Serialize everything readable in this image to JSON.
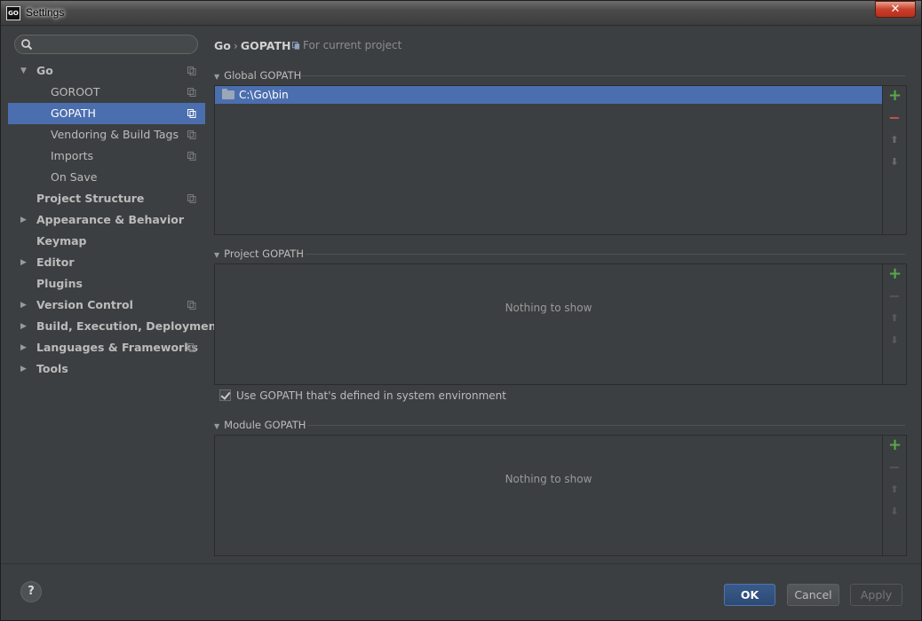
{
  "window": {
    "title": "Settings",
    "app_icon_text": "GO",
    "close_glyph": "✕"
  },
  "search": {
    "placeholder": ""
  },
  "sidebar": {
    "items": [
      {
        "label": "Go",
        "bold": true,
        "expanded": true,
        "has_arrow": true,
        "indent": 1,
        "project_icon": true,
        "selected": false
      },
      {
        "label": "GOROOT",
        "bold": false,
        "has_arrow": false,
        "indent": 2,
        "project_icon": true,
        "selected": false
      },
      {
        "label": "GOPATH",
        "bold": false,
        "has_arrow": false,
        "indent": 2,
        "project_icon": true,
        "selected": true
      },
      {
        "label": "Vendoring & Build Tags",
        "bold": false,
        "has_arrow": false,
        "indent": 2,
        "project_icon": true,
        "selected": false
      },
      {
        "label": "Imports",
        "bold": false,
        "has_arrow": false,
        "indent": 2,
        "project_icon": true,
        "selected": false
      },
      {
        "label": "On Save",
        "bold": false,
        "has_arrow": false,
        "indent": 2,
        "project_icon": false,
        "selected": false
      },
      {
        "label": "Project Structure",
        "bold": true,
        "has_arrow": false,
        "indent": 1,
        "project_icon": true,
        "selected": false
      },
      {
        "label": "Appearance & Behavior",
        "bold": true,
        "has_arrow": true,
        "expanded": false,
        "indent": 1,
        "project_icon": false,
        "selected": false
      },
      {
        "label": "Keymap",
        "bold": true,
        "has_arrow": false,
        "indent": 1,
        "project_icon": false,
        "selected": false
      },
      {
        "label": "Editor",
        "bold": true,
        "has_arrow": true,
        "expanded": false,
        "indent": 1,
        "project_icon": false,
        "selected": false
      },
      {
        "label": "Plugins",
        "bold": true,
        "has_arrow": false,
        "indent": 1,
        "project_icon": false,
        "selected": false
      },
      {
        "label": "Version Control",
        "bold": true,
        "has_arrow": true,
        "expanded": false,
        "indent": 1,
        "project_icon": true,
        "selected": false
      },
      {
        "label": "Build, Execution, Deployment",
        "bold": true,
        "has_arrow": true,
        "expanded": false,
        "indent": 1,
        "project_icon": false,
        "selected": false
      },
      {
        "label": "Languages & Frameworks",
        "bold": true,
        "has_arrow": true,
        "expanded": false,
        "indent": 1,
        "project_icon": true,
        "selected": false
      },
      {
        "label": "Tools",
        "bold": true,
        "has_arrow": true,
        "expanded": false,
        "indent": 1,
        "project_icon": false,
        "selected": false
      }
    ]
  },
  "main": {
    "breadcrumb": {
      "parent": "Go",
      "separator": "›",
      "current": "GOPATH"
    },
    "hint": "For current project",
    "global_gopath": {
      "title": "Global GOPATH",
      "entries": [
        "C:\\Go\\bin"
      ]
    },
    "project_gopath": {
      "title": "Project GOPATH",
      "empty_text": "Nothing to show"
    },
    "use_system_env": {
      "label": "Use GOPATH that's defined in system environment",
      "checked": true
    },
    "module_gopath": {
      "title": "Module GOPATH",
      "empty_text": "Nothing to show"
    },
    "toolbar_glyphs": {
      "add": "+",
      "remove": "−",
      "up": "⬆",
      "down": "⬇"
    }
  },
  "footer": {
    "help": "?",
    "ok": "OK",
    "cancel": "Cancel",
    "apply": "Apply"
  },
  "colors": {
    "accent": "#4b6eaf",
    "add": "#59a84a",
    "remove": "#c75450",
    "background": "#3c3f41"
  }
}
